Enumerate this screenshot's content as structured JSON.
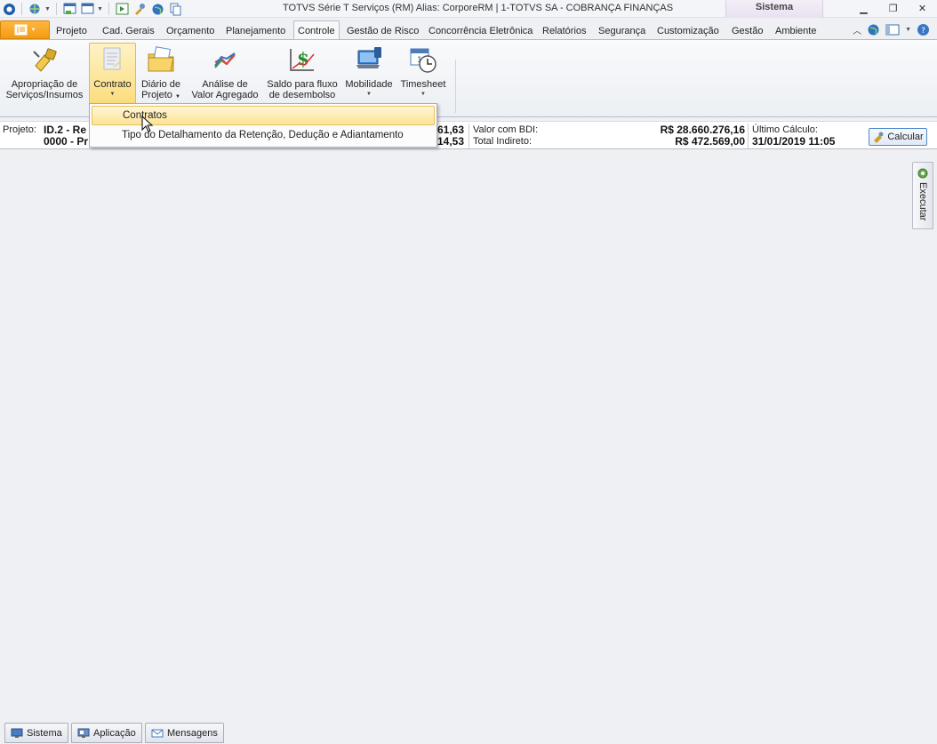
{
  "window": {
    "title": "TOTVS Série T Serviços (RM) Alias: CorporeRM | 1-TOTVS SA - COBRANÇA FINANÇAS",
    "context_tab": "Sistema"
  },
  "ribbon_tabs": [
    {
      "label": "Projeto"
    },
    {
      "label": "Cad. Gerais"
    },
    {
      "label": "Orçamento"
    },
    {
      "label": "Planejamento"
    },
    {
      "label": "Controle",
      "active": true
    },
    {
      "label": "Gestão de Risco"
    },
    {
      "label": "Concorrência Eletrônica"
    },
    {
      "label": "Relatórios"
    },
    {
      "label": "Segurança"
    },
    {
      "label": "Customização"
    },
    {
      "label": "Gestão"
    },
    {
      "label": "Ambiente"
    }
  ],
  "ribbon_buttons": {
    "apropriacao": {
      "line1": "Apropriação de",
      "line2": "Serviços/Insumos"
    },
    "contrato": {
      "line1": "Contrato"
    },
    "diario": {
      "line1": "Diário de",
      "line2": "Projeto"
    },
    "analise": {
      "line1": "Análise de",
      "line2": "Valor Agregado"
    },
    "saldo": {
      "line1": "Saldo para fluxo",
      "line2": "de desembolso"
    },
    "mobilidade": {
      "line1": "Mobilidade"
    },
    "timesheet": {
      "line1": "Timesheet"
    }
  },
  "dropdown": {
    "items": [
      {
        "label": "Contratos"
      },
      {
        "label": "Tipo do Detalhamento da Retenção, Dedução e Adiantamento"
      }
    ]
  },
  "info": {
    "projeto_label": "Projeto:",
    "projeto_line1": "ID.2 - Re",
    "projeto_line2": "0000 - Pr",
    "val1_partial": "61,63",
    "val2_partial": "14,53",
    "valor_bdi_label": "Valor com BDI:",
    "valor_bdi_value": "R$ 28.660.276,16",
    "total_indireto_label": "Total Indireto:",
    "total_indireto_value": "R$ 472.569,00",
    "ultimo_calculo_label": "Último Cálculo:",
    "ultimo_calculo_value": "31/01/2019 11:05",
    "calcular_label": "Calcular"
  },
  "side_panel": {
    "label": "Executar"
  },
  "bottom_tabs": [
    {
      "label": "Sistema"
    },
    {
      "label": "Aplicação"
    },
    {
      "label": "Mensagens"
    }
  ]
}
